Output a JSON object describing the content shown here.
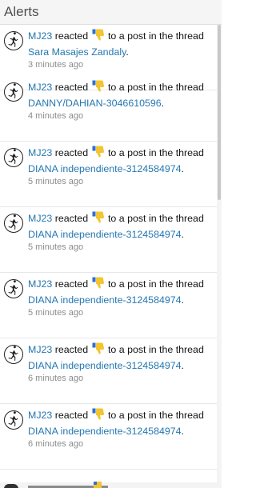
{
  "header": {
    "title": "Alerts"
  },
  "alerts": [
    {
      "user": "MJ23",
      "reaction_icon": "thumbs-down-icon",
      "middle": " to a post in the thread ",
      "thread": "Sara Masajes Zandaly",
      "end": ".",
      "time": "3 minutes ago"
    },
    {
      "user": "MJ23",
      "reaction_icon": "thumbs-down-icon",
      "middle": " to a post in the thread ",
      "thread": "DANNY/DAHIAN-3046610596",
      "end": ".",
      "time": "4 minutes ago"
    },
    {
      "user": "MJ23",
      "reaction_icon": "thumbs-down-icon",
      "middle": " to a post in the thread ",
      "thread": "DIANA independiente-3124584974",
      "end": ".",
      "time": "5 minutes ago"
    },
    {
      "user": "MJ23",
      "reaction_icon": "thumbs-down-icon",
      "middle": " to a post in the thread ",
      "thread": "DIANA independiente-3124584974",
      "end": ".",
      "time": "5 minutes ago"
    },
    {
      "user": "MJ23",
      "reaction_icon": "thumbs-down-icon",
      "middle": " to a post in the thread ",
      "thread": "DIANA independiente-3124584974",
      "end": ".",
      "time": "5 minutes ago"
    },
    {
      "user": "MJ23",
      "reaction_icon": "thumbs-down-icon",
      "middle": " to a post in the thread ",
      "thread": "DIANA independiente-3124584974",
      "end": ".",
      "time": "6 minutes ago"
    },
    {
      "user": "MJ23",
      "reaction_icon": "thumbs-down-icon",
      "middle": " to a post in the thread ",
      "thread": "DIANA independiente-3124584974",
      "end": ".",
      "time": "6 minutes ago"
    }
  ],
  "verb": " reacted ",
  "colors": {
    "link": "#2577b1",
    "time": "#8c8c8c",
    "header_bg": "#f5f5f5"
  }
}
